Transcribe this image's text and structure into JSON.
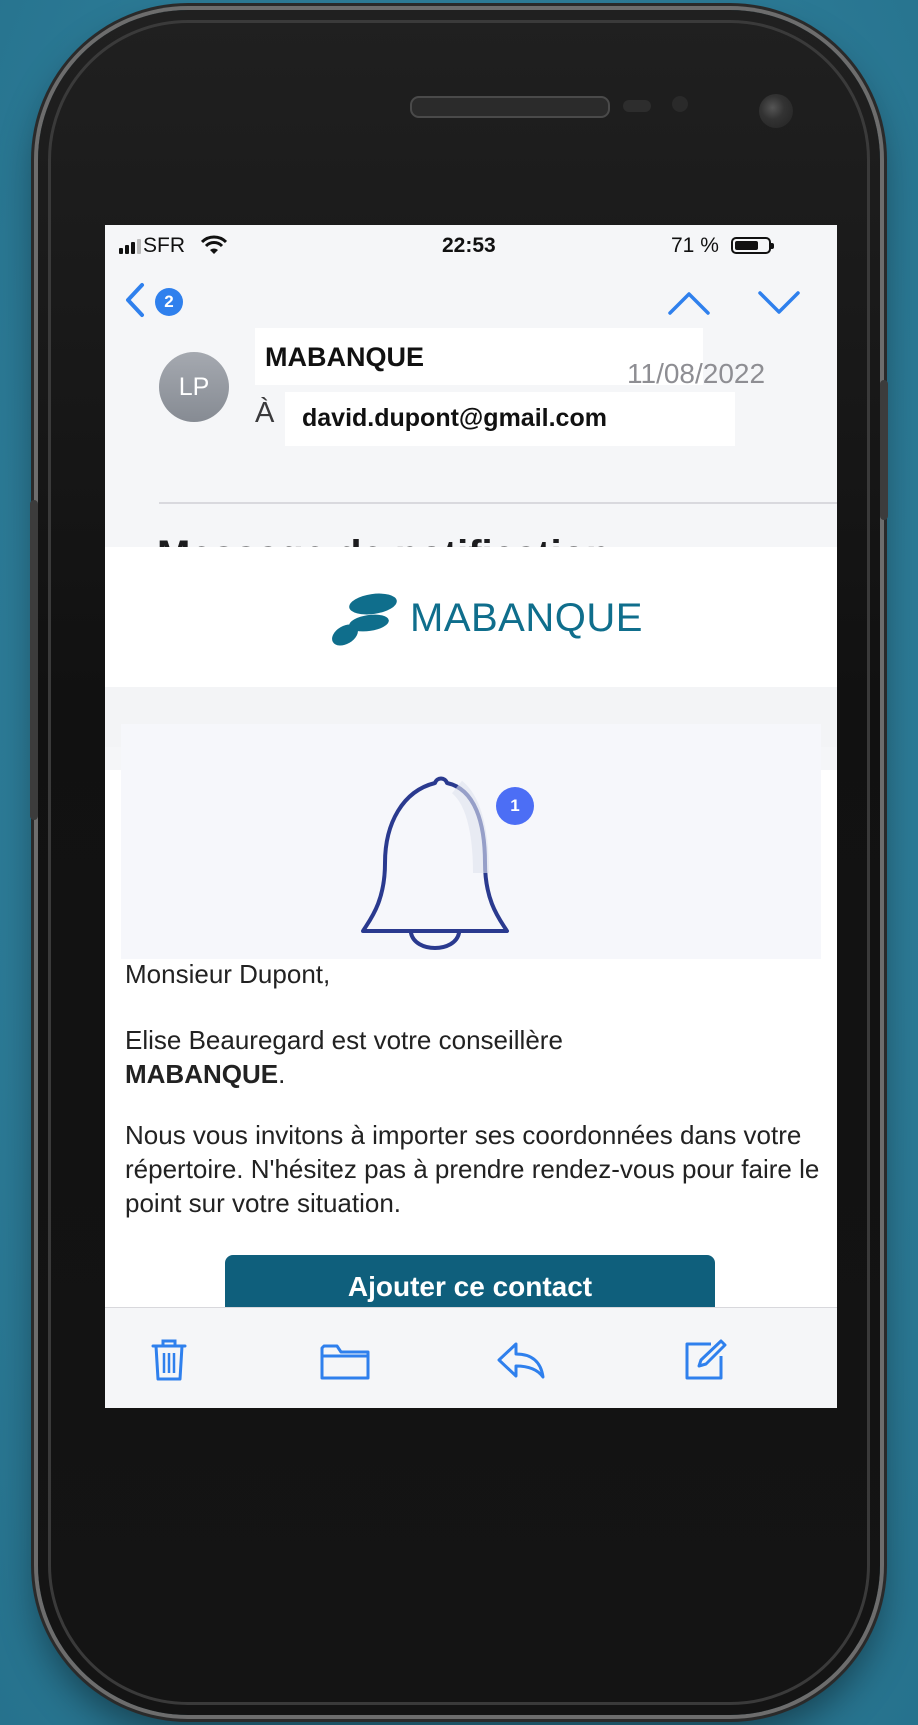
{
  "status_bar": {
    "carrier": "SFR",
    "time": "22:53",
    "battery_percent_text": "71 %",
    "battery_level": 0.71
  },
  "nav": {
    "back_count": "2"
  },
  "email": {
    "avatar_initials": "LP",
    "sender": "MABANQUE",
    "date": "11/08/2022",
    "to_label": "À :",
    "to_address": "david.dupont@gmail.com",
    "subject": "Message de notification"
  },
  "body": {
    "logo_text": "MABANQUE",
    "bell_badge": "1",
    "greeting": "Monsieur Dupont,",
    "line1": "Elise Beauregard est votre conseillère",
    "line1_bold": "MABANQUE",
    "line1_end": ".",
    "paragraph": "Nous vous invitons à importer ses coordonnées dans votre répertoire. N'hésitez pas à prendre rendez-vous pour faire le point sur votre situation.",
    "cta_label": "Ajouter ce contact"
  },
  "toolbar": {
    "icons": [
      "trash-icon",
      "folder-icon",
      "reply-icon",
      "compose-icon"
    ]
  },
  "colors": {
    "brand": "#0f6e8c",
    "accent": "#2f80ed",
    "badge": "#4c6ef5",
    "background": "#2f7f9b"
  }
}
